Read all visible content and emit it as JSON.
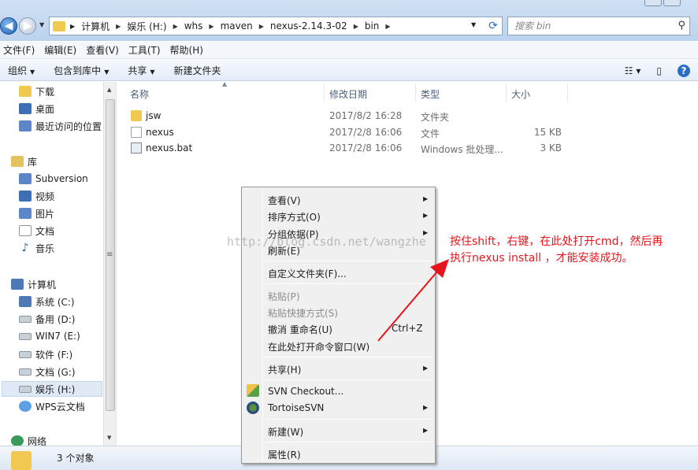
{
  "address": {
    "crumbs": [
      "计算机",
      "娱乐 (H:)",
      "whs",
      "maven",
      "nexus-2.14.3-02",
      "bin"
    ],
    "search_placeholder": "搜索 bin"
  },
  "menubar": [
    "文件(F)",
    "编辑(E)",
    "查看(V)",
    "工具(T)",
    "帮助(H)"
  ],
  "toolbar": {
    "organize": "组织",
    "include_library": "包含到库中",
    "share": "共享",
    "new_folder": "新建文件夹"
  },
  "nav": {
    "favorites": [
      "下载",
      "桌面",
      "最近访问的位置"
    ],
    "libraries_header": "库",
    "libraries": [
      "Subversion",
      "视频",
      "图片",
      "文档",
      "音乐"
    ],
    "computer_header": "计算机",
    "drives": [
      "系统 (C:)",
      "备用 (D:)",
      "WIN7 (E:)",
      "软件 (F:)",
      "文档 (G:)",
      "娱乐 (H:)"
    ],
    "wps": "WPS云文档",
    "network": "网络"
  },
  "columns": {
    "name": "名称",
    "modified": "修改日期",
    "type": "类型",
    "size": "大小"
  },
  "files": [
    {
      "name": "jsw",
      "modified": "2017/8/2 16:28",
      "type": "文件夹",
      "size": ""
    },
    {
      "name": "nexus",
      "modified": "2017/2/8 16:06",
      "type": "文件",
      "size": "15 KB"
    },
    {
      "name": "nexus.bat",
      "modified": "2017/2/8 16:06",
      "type": "Windows 批处理...",
      "size": "3 KB"
    }
  ],
  "context_menu": {
    "view": "查看(V)",
    "sort": "排序方式(O)",
    "group": "分组依据(P)",
    "refresh": "刷新(E)",
    "customize": "自定义文件夹(F)...",
    "paste": "粘贴(P)",
    "paste_shortcut": "粘贴快捷方式(S)",
    "undo_rename": "撤消 重命名(U)",
    "undo_shortcut": "Ctrl+Z",
    "open_cmd": "在此处打开命令窗口(W)",
    "share": "共享(H)",
    "svn_checkout": "SVN Checkout...",
    "tortoise": "TortoiseSVN",
    "new": "新建(W)",
    "properties": "属性(R)"
  },
  "watermark": "http://blog.csdn.net/wangzhe",
  "annotation": {
    "line1": "按住shift，右键，在此处打开cmd，然后再",
    "line2": "执行nexus install ，才能安装成功。",
    "color": "#e8141b"
  },
  "status": {
    "count": "3 个对象"
  }
}
